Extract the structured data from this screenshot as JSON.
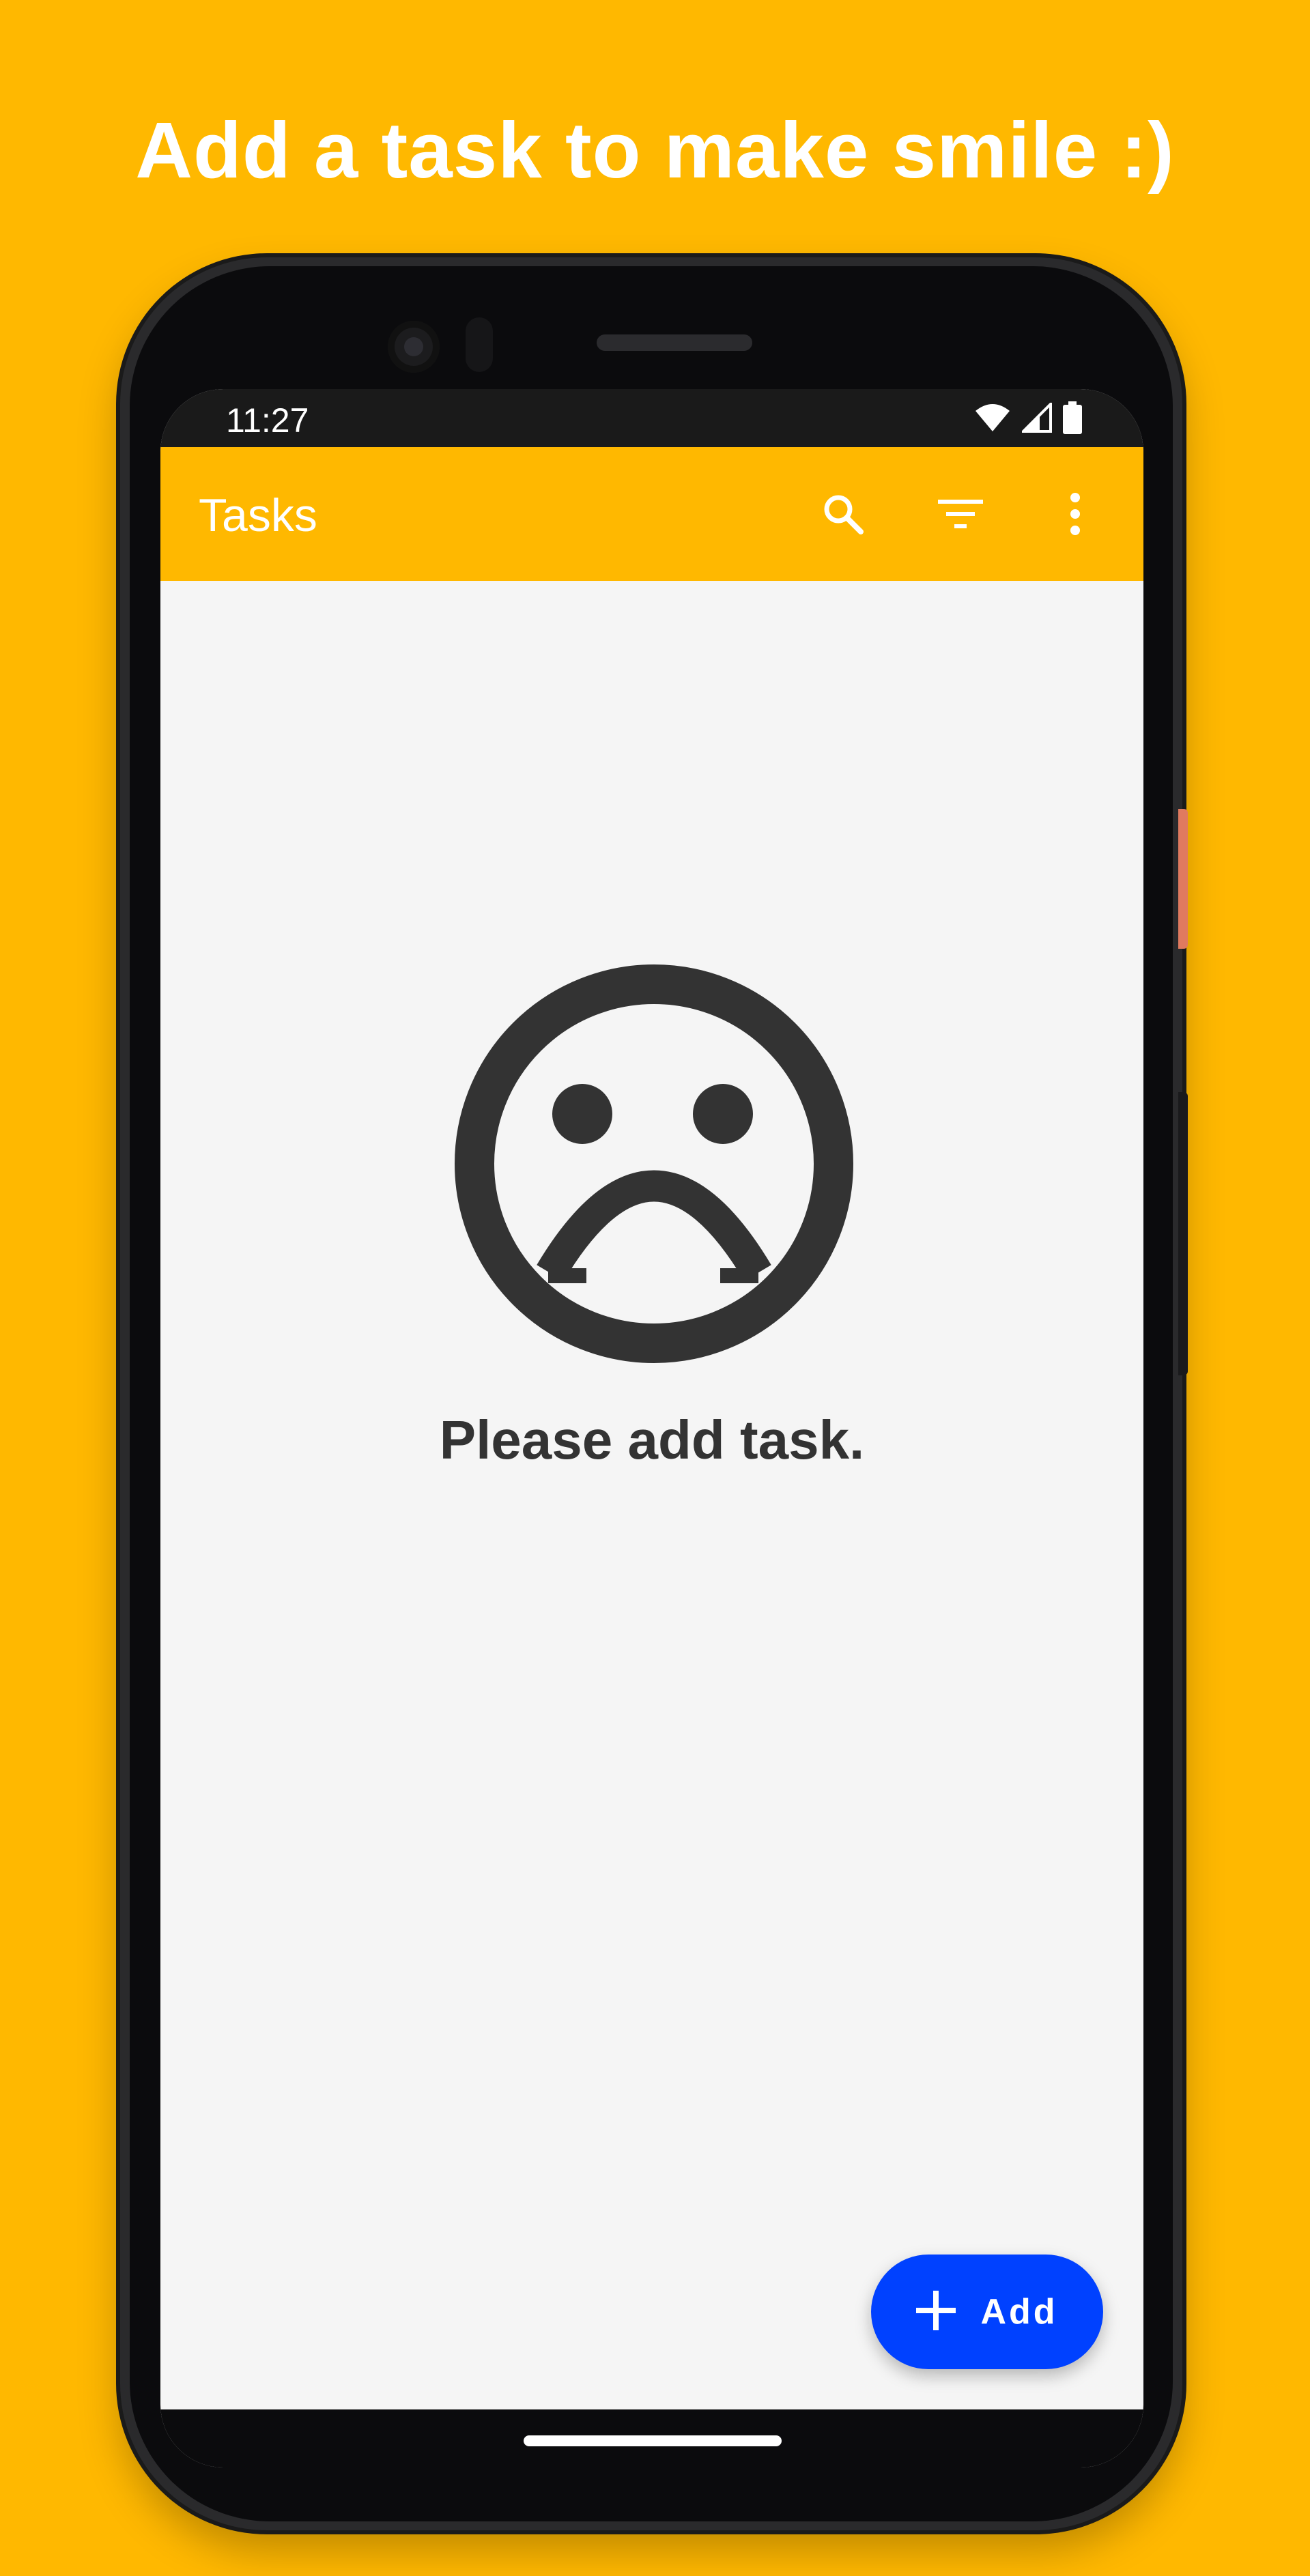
{
  "headline": "Add a task to make smile :)",
  "colors": {
    "accent": "#FFB800",
    "fab": "#0041FF",
    "empty_text": "#333333",
    "screen_bg": "#F5F5F5"
  },
  "status_bar": {
    "time": "11:27",
    "icons": [
      "wifi-icon",
      "cellular-signal-icon",
      "battery-icon"
    ]
  },
  "app_bar": {
    "title": "Tasks",
    "actions": [
      "search-icon",
      "filter-icon",
      "more-vert-icon"
    ]
  },
  "empty_state": {
    "icon": "sad-face-icon",
    "message": "Please add task."
  },
  "fab": {
    "icon": "plus-icon",
    "label": "Add"
  }
}
